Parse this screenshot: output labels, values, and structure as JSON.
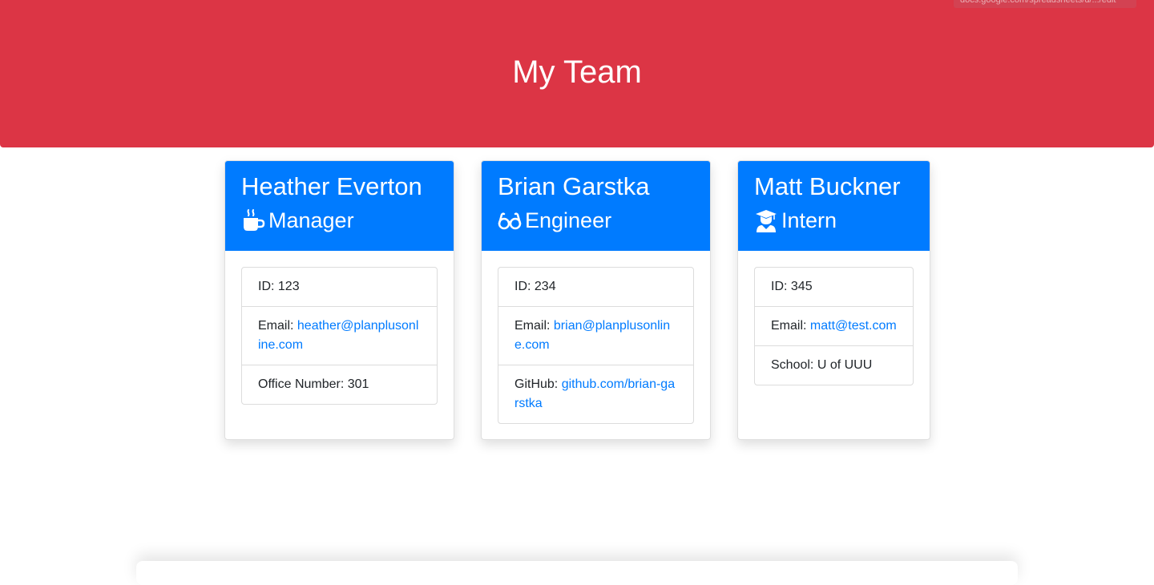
{
  "header": {
    "title": "My Team",
    "tooltip_url": "docs.google.com/spreadsheets/d/.../edit",
    "background_color": "#dc3545"
  },
  "accent_color": "#007bff",
  "cards": [
    {
      "name": "Heather Everton",
      "role": "Manager",
      "role_icon": "mug-icon",
      "id_label": "ID: ",
      "id_value": "123",
      "email_label": "Email: ",
      "email": "heather@planplusonline.com",
      "extra_label": "Office Number: ",
      "extra_value": "301"
    },
    {
      "name": "Brian Garstka",
      "role": "Engineer",
      "role_icon": "glasses-icon",
      "id_label": "ID: ",
      "id_value": "234",
      "email_label": "Email: ",
      "email": "brian@planplusonline.com",
      "extra_label": "GitHub: ",
      "extra_value": "github.com/brian-garstka"
    },
    {
      "name": "Matt Buckner",
      "role": "Intern",
      "role_icon": "graduate-icon",
      "id_label": "ID: ",
      "id_value": "345",
      "email_label": "Email: ",
      "email": "matt@test.com",
      "extra_label": "School: ",
      "extra_value": "U of UUU"
    }
  ]
}
